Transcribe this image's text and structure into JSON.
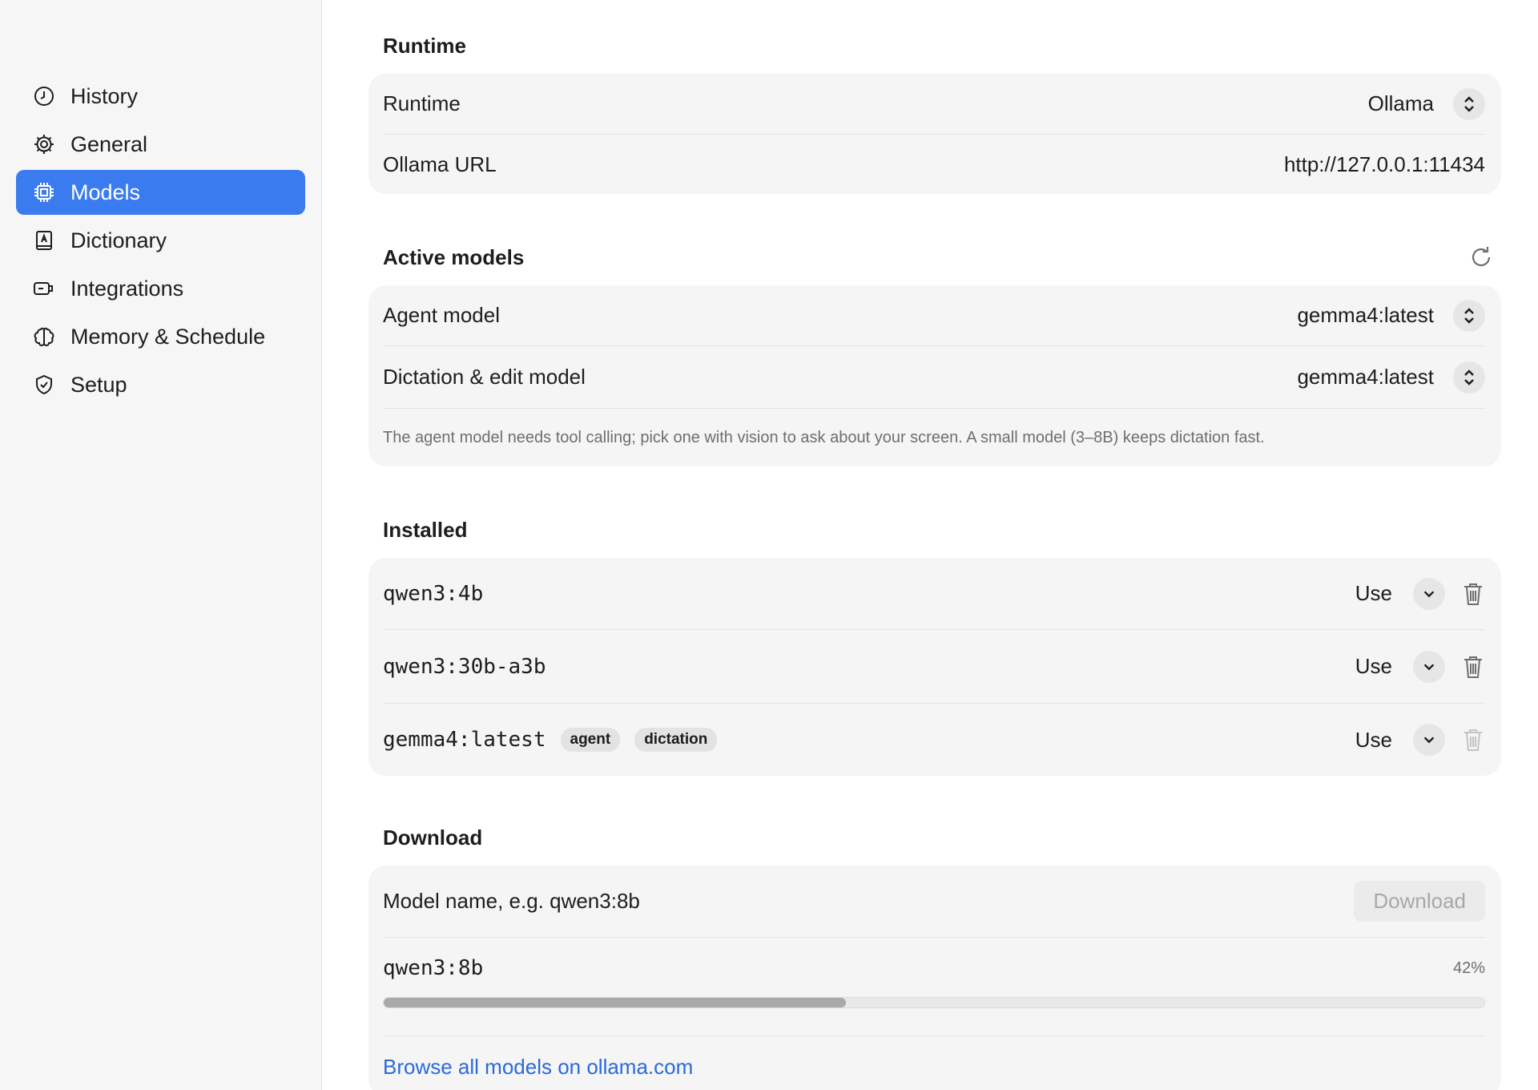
{
  "sidebar": {
    "items": [
      {
        "label": "History",
        "icon": "clock-icon"
      },
      {
        "label": "General",
        "icon": "gear-icon"
      },
      {
        "label": "Models",
        "icon": "chip-icon",
        "active": true
      },
      {
        "label": "Dictionary",
        "icon": "book-icon"
      },
      {
        "label": "Integrations",
        "icon": "plug-icon"
      },
      {
        "label": "Memory & Schedule",
        "icon": "brain-icon"
      },
      {
        "label": "Setup",
        "icon": "shield-check-icon"
      }
    ]
  },
  "runtime": {
    "title": "Runtime",
    "runtime_label": "Runtime",
    "runtime_value": "Ollama",
    "url_label": "Ollama URL",
    "url_value": "http://127.0.0.1:11434"
  },
  "active_models": {
    "title": "Active models",
    "agent_label": "Agent model",
    "agent_value": "gemma4:latest",
    "dictation_label": "Dictation & edit model",
    "dictation_value": "gemma4:latest",
    "hint": "The agent model needs tool calling; pick one with vision to ask about your screen. A small model (3–8B) keeps dictation fast."
  },
  "installed": {
    "title": "Installed",
    "models": [
      {
        "name": "qwen3:4b",
        "use_label": "Use",
        "tags": []
      },
      {
        "name": "qwen3:30b-a3b",
        "use_label": "Use",
        "tags": []
      },
      {
        "name": "gemma4:latest",
        "use_label": "Use",
        "tags": [
          "agent",
          "dictation"
        ]
      }
    ]
  },
  "download": {
    "title": "Download",
    "placeholder": "Model name, e.g. qwen3:8b",
    "button_label": "Download",
    "in_progress_name": "qwen3:8b",
    "progress_text": "42%",
    "progress_fraction": 0.42,
    "browse_link": "Browse all models on ollama.com"
  },
  "colors": {
    "accent": "#3a7bef",
    "link": "#2a6ad8"
  }
}
